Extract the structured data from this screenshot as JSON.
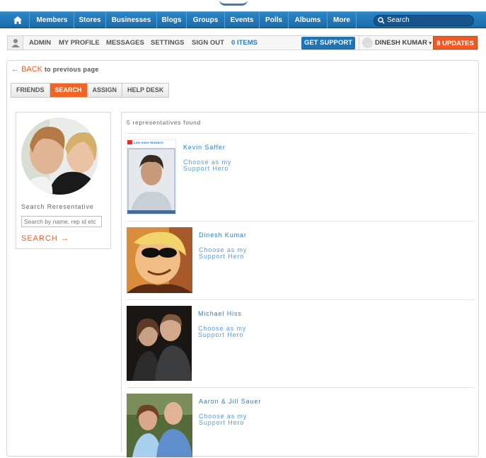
{
  "topnav": {
    "items": [
      "Members",
      "Stores",
      "Businesses",
      "Blogs",
      "Groups",
      "Events",
      "Polls",
      "Albums",
      "More"
    ],
    "search_placeholder": "Search"
  },
  "userbar": {
    "links": [
      "ADMIN",
      "MY PROFILE",
      "MESSAGES",
      "SETTINGS",
      "SIGN OUT"
    ],
    "items_label": "0 ITEMS",
    "get_support": "GET SUPPORT",
    "user_name": "DINESH KUMAR",
    "updates": "8 UPDATES"
  },
  "back": {
    "link": "BACK",
    "text": "to previous page"
  },
  "tabs": [
    {
      "label": "FRIENDS",
      "active": false
    },
    {
      "label": "SEARCH",
      "active": true
    },
    {
      "label": "ASSIGN",
      "active": false
    },
    {
      "label": "HELP DESK",
      "active": false
    }
  ],
  "search_panel": {
    "label": "Search Reresentative",
    "placeholder": "Search by name, rep id etc",
    "button": "SEARCH"
  },
  "results": {
    "count_text": "5 representatives found",
    "choose_line1": "Choose as my",
    "choose_line2": "Support Hero",
    "reps": [
      {
        "name": "Kevin Saffer",
        "sticker_text": "Lots more Stickers!"
      },
      {
        "name": "Dinesh Kumar"
      },
      {
        "name": "Michael Hiss"
      },
      {
        "name": "Aaron & Jill Sauer"
      }
    ]
  },
  "colors": {
    "nav_blue": "#1f73b7",
    "accent_orange": "#f05a22",
    "link_blue": "#2c7fc0"
  }
}
